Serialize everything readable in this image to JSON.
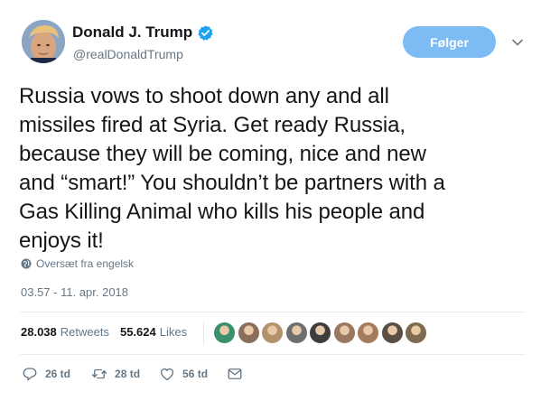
{
  "author": {
    "name": "Donald J. Trump",
    "handle": "@realDonaldTrump",
    "verified": true
  },
  "follow_button": {
    "label": "Følger",
    "color": "#7cbbf3"
  },
  "tweet": {
    "lines": [
      "Russia vows to shoot down any and all",
      "missiles fired at Syria. Get ready Russia,",
      "because they will be coming, nice and new",
      "and “smart!” You shouldn’t be partners with a",
      "Gas Killing Animal who kills his people and",
      "enjoys it!"
    ]
  },
  "translate_label": "Oversæt fra engelsk",
  "timestamp": "03.57 - 11. apr. 2018",
  "stats": {
    "retweets_count": "28.038",
    "retweets_label": "Retweets",
    "likes_count": "55.624",
    "likes_label": "Likes"
  },
  "likers": [
    {
      "name": "liker-1",
      "color": "#3b8f6a"
    },
    {
      "name": "liker-2",
      "color": "#8a6d5a"
    },
    {
      "name": "liker-3",
      "color": "#b4916d"
    },
    {
      "name": "liker-4",
      "color": "#6f6f6f"
    },
    {
      "name": "liker-5",
      "color": "#3d3d3d"
    },
    {
      "name": "liker-6",
      "color": "#9a7860"
    },
    {
      "name": "liker-7",
      "color": "#a47b5c"
    },
    {
      "name": "liker-8",
      "color": "#5a4e45"
    },
    {
      "name": "liker-9",
      "color": "#7d6a4f"
    }
  ],
  "actions": {
    "reply_count": "26 td",
    "retweet_count": "28 td",
    "like_count": "56 td"
  },
  "icons": {
    "verified": "verified-badge-icon",
    "caret": "chevron-down-icon",
    "globe": "globe-icon",
    "reply": "reply-icon",
    "retweet": "retweet-icon",
    "like": "heart-icon",
    "message": "envelope-icon"
  },
  "colors": {
    "text": "#14171a",
    "secondary": "#657786",
    "verified": "#1da1f2",
    "divider": "#e6ecf0"
  }
}
